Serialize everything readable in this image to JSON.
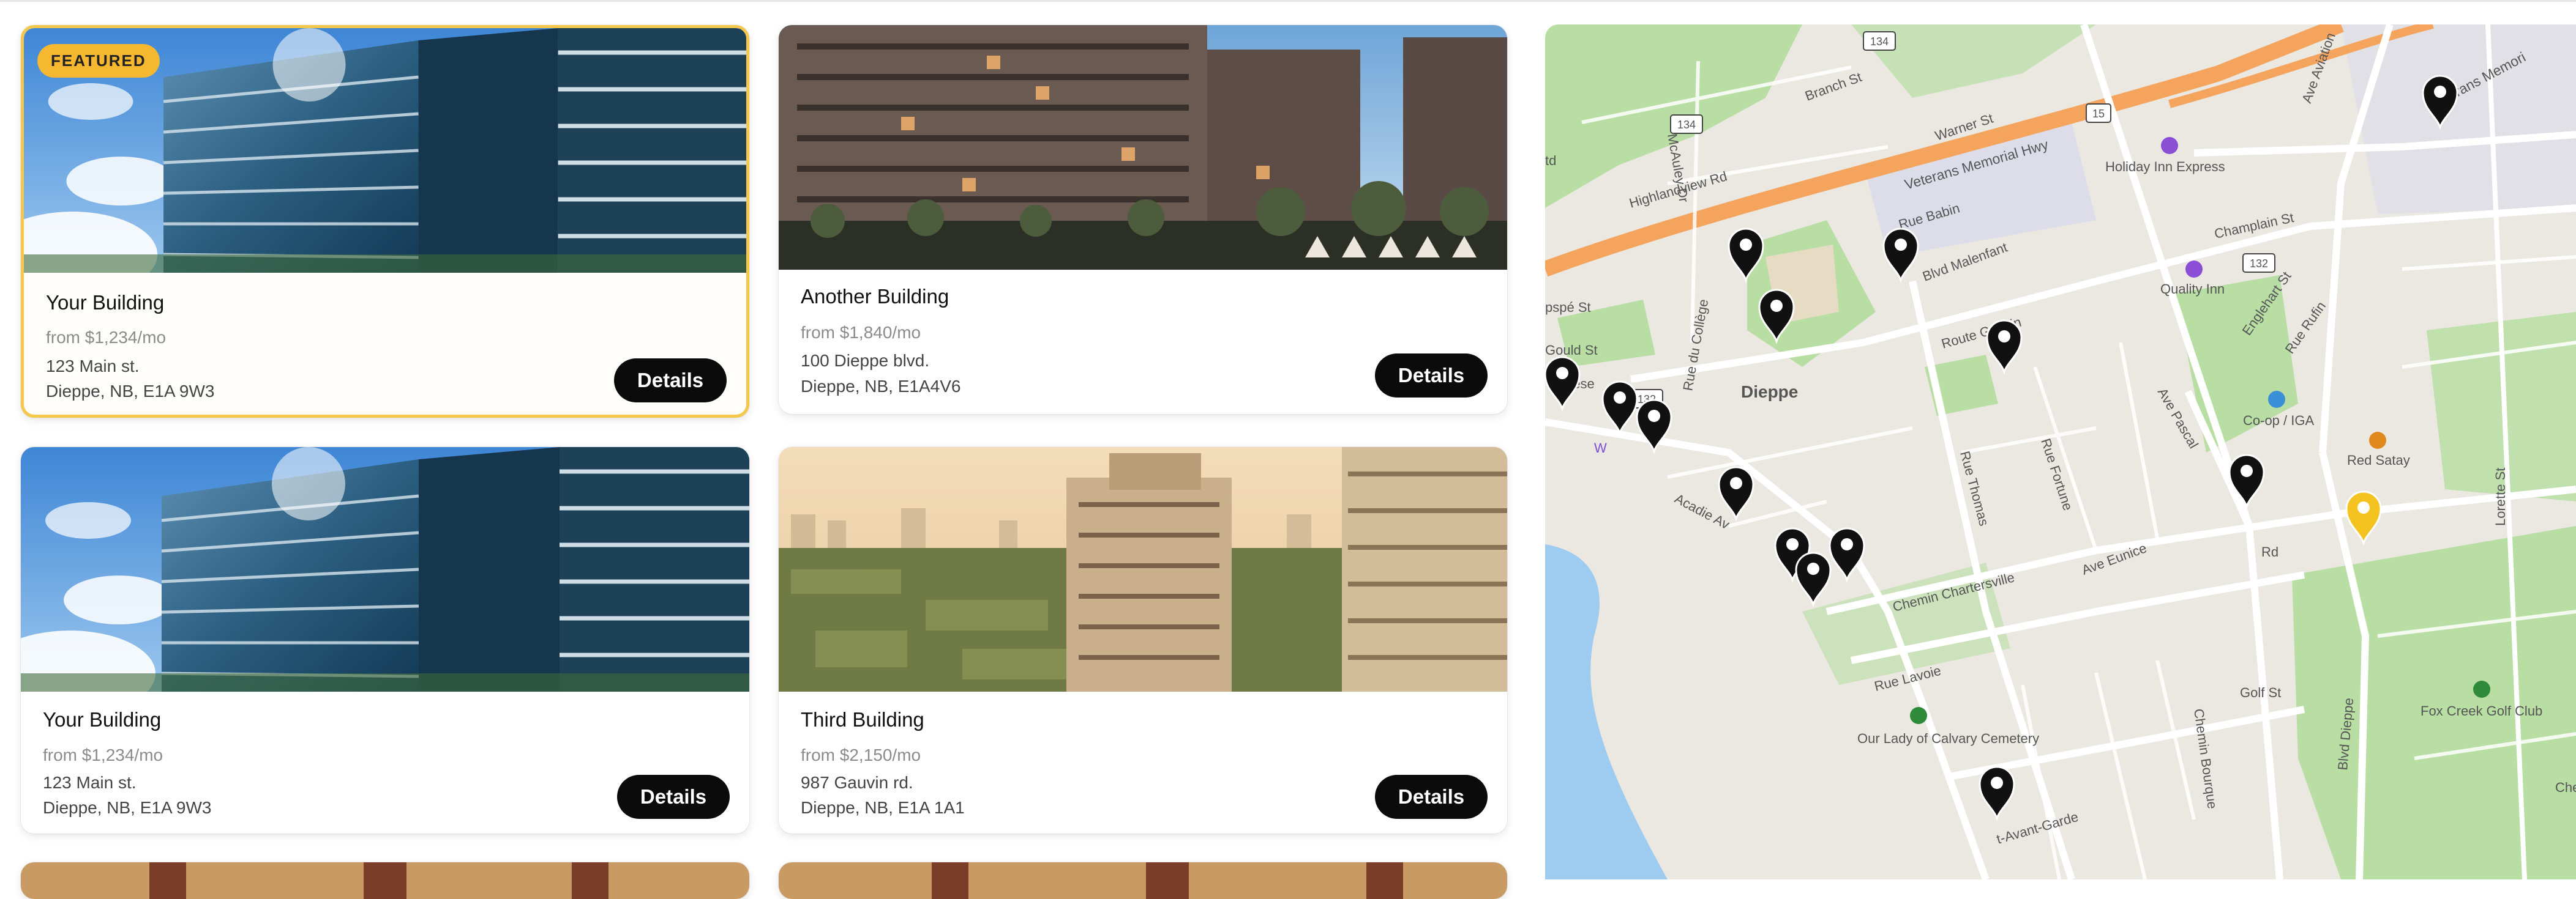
{
  "listings": [
    {
      "name": "Your Building",
      "price": "from $1,234/mo",
      "address_line1": "123 Main st.",
      "address_line2": "Dieppe, NB, E1A 9W3",
      "button": "Details",
      "badge": "FEATURED"
    },
    {
      "name": "Another Building",
      "price": "from $1,840/mo",
      "address_line1": "100 Dieppe blvd.",
      "address_line2": "Dieppe, NB, E1A4V6",
      "button": "Details"
    },
    {
      "name": "Your Building",
      "price": "from $1,234/mo",
      "address_line1": "123 Main st.",
      "address_line2": "Dieppe, NB, E1A 9W3",
      "button": "Details"
    },
    {
      "name": "Third Building",
      "price": "from $2,150/mo",
      "address_line1": "987 Gauvin rd.",
      "address_line2": "Dieppe, NB, E1A 1A1",
      "button": "Details"
    }
  ],
  "map": {
    "city": "Dieppe",
    "streets": [
      "Branch St",
      "Warner St",
      "Veterans Memorial Hwy",
      "Veterans Memori",
      "Highlandview Rd",
      "McAuley Dr",
      "Rue Babin",
      "Blvd Malenfant",
      "Champlain St",
      "Englehart St",
      "Rue Rufin",
      "Route Gauvin",
      "Rue du Collège",
      "Gould St",
      "pspé St",
      "Thérèse",
      "Acadie Av",
      "Rue Thomas",
      "Rue Fortune",
      "Ave Pascal",
      "Chemin Chartersville",
      "Ave Eunice",
      "Rue Lavoie",
      "Chemin Bourque",
      "Blvd Dieppe",
      "Golf St",
      "Lorette St",
      "Ave Aviation",
      "t-Avant-Garde",
      "Rd",
      "Che",
      "td",
      "W"
    ],
    "route_shields": [
      "134",
      "134",
      "15",
      "132",
      "132"
    ],
    "pois": [
      {
        "name": "Holiday Inn Express",
        "color": "#8b4fd6"
      },
      {
        "name": "Quality Inn",
        "color": "#8b4fd6"
      },
      {
        "name": "Co-op / IGA",
        "color": "#3b8fd6"
      },
      {
        "name": "Red Satay",
        "color": "#e08a1e"
      },
      {
        "name": "Our Lady of Calvary Cemetery",
        "color": "#2f8a3a"
      },
      {
        "name": "Fox Creek Golf Club",
        "color": "#2f8a3a"
      }
    ],
    "pin_color": "#111111",
    "highlight_pin_color": "#f5c320",
    "accent": "#f6b731"
  }
}
